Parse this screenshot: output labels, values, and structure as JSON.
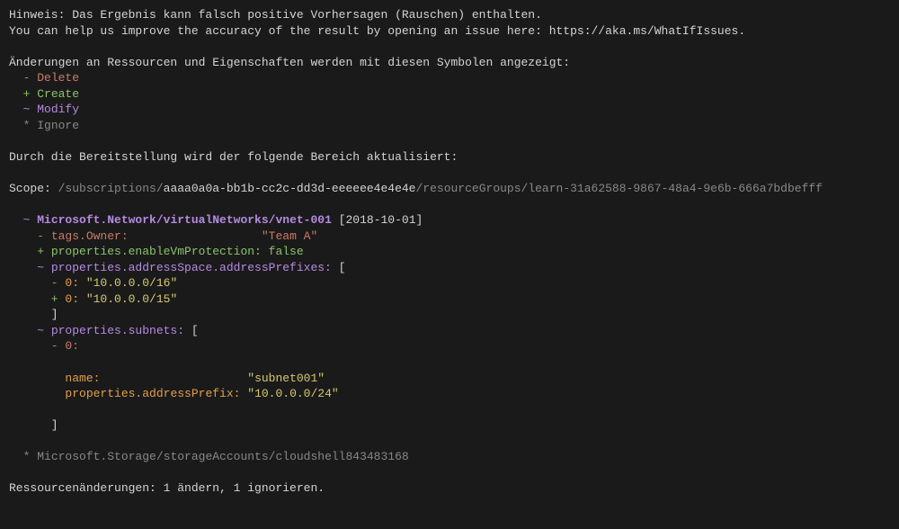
{
  "header": {
    "hint": "Hinweis: Das Ergebnis kann falsch positive Vorhersagen (Rauschen) enthalten.",
    "improve": "You can help us improve the accuracy of the result by opening an issue here: https://aka.ms/WhatIfIssues.",
    "legend_intro": "Änderungen an Ressourcen und Eigenschaften werden mit diesen Symbolen angezeigt:",
    "delete_mark": "  - ",
    "delete_label": "Delete",
    "create_mark": "  + ",
    "create_label": "Create",
    "modify_mark": "  ~ ",
    "modify_label": "Modify",
    "ignore_mark": "  * ",
    "ignore_label": "Ignore",
    "scope_intro": "Durch die Bereitstellung wird der folgende Bereich aktualisiert:",
    "scope_label": "Scope: ",
    "scope_prefix": "/subscriptions/",
    "scope_sub": "aaaa0a0a-bb1b-cc2c-dd3d-eeeeee4e4e4e",
    "scope_suffix": "/resourceGroups/learn-31a62588-9867-48a4-9e6b-666a7bdbefff"
  },
  "res": {
    "modify_tilde": "  ~ ",
    "vnet_path": "Microsoft.Network/virtualNetworks/vnet-001",
    "vnet_version_open": " [",
    "vnet_version": "2018-10-01",
    "vnet_version_close": "]",
    "tags_minus": "    - ",
    "tags_key": "tags.Owner:",
    "tags_pad": "                   ",
    "tags_val": "\"Team A\"",
    "vmprot_plus": "    + ",
    "vmprot_key": "properties.enableVmProtection: ",
    "vmprot_val": "false",
    "addr_tilde": "    ~ ",
    "addr_key": "properties.addressSpace.addressPrefixes:",
    "addr_open": " [",
    "addr_minus": "      - ",
    "addr_old_key": "0: ",
    "addr_old_val": "\"10.0.0.0/16\"",
    "addr_plus": "      + ",
    "addr_new_key": "0: ",
    "addr_new_val": "\"10.0.0.0/15\"",
    "addr_close": "      ]",
    "sub_tilde": "    ~ ",
    "sub_key": "properties.subnets:",
    "sub_open": " [",
    "sub_minus": "      - ",
    "sub_idx": "0:",
    "sub_name_pad": "        ",
    "sub_name_key": "name:",
    "sub_name_space": "                     ",
    "sub_name_val": "\"subnet001\"",
    "sub_pref_pad": "        ",
    "sub_pref_key": "properties.addressPrefix: ",
    "sub_pref_val": "\"10.0.0.0/24\"",
    "sub_close": "      ]",
    "ignore_star": "  * ",
    "storage_path": "Microsoft.Storage/storageAccounts/cloudshell843483168"
  },
  "footer": {
    "summary": "Ressourcenänderungen: 1 ändern, 1 ignorieren."
  }
}
